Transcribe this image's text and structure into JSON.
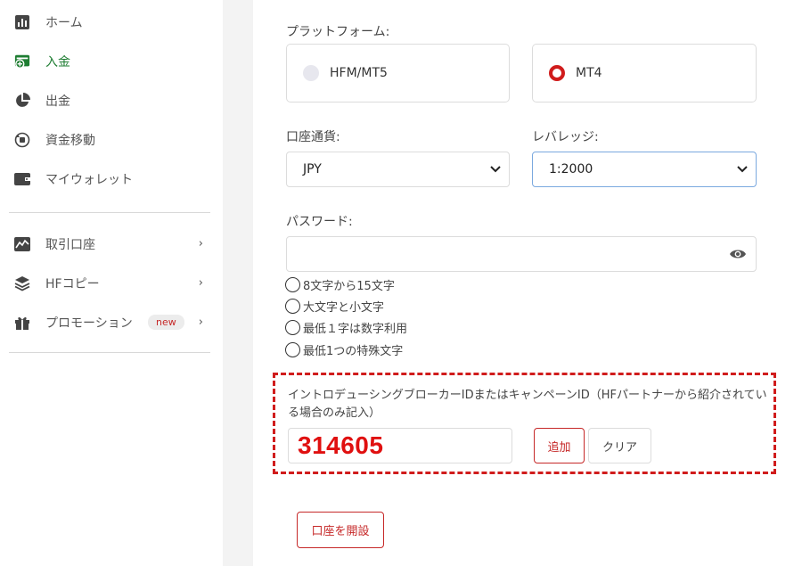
{
  "sidebar": {
    "items": [
      {
        "label": "ホーム"
      },
      {
        "label": "入金"
      },
      {
        "label": "出金"
      },
      {
        "label": "資金移動"
      },
      {
        "label": "マイウォレット"
      },
      {
        "label": "取引口座"
      },
      {
        "label": "HFコピー"
      },
      {
        "label": "プロモーション",
        "badge": "new"
      }
    ],
    "active_color": "#1e7d32"
  },
  "form": {
    "platform_label": "プラットフォーム:",
    "platform_options": [
      {
        "label": "HFM/MT5",
        "selected": false
      },
      {
        "label": "MT4",
        "selected": true
      }
    ],
    "currency_label": "口座通貨:",
    "currency_value": "JPY",
    "leverage_label": "レバレッジ:",
    "leverage_value": "1:2000",
    "password_label": "パスワード:",
    "password_value": "",
    "password_rules": [
      "8文字から15文字",
      "大文字と小文字",
      "最低１字は数字利用",
      "最低1つの特殊文字"
    ],
    "promo_label": "イントロデューシングブローカーIDまたはキャンペーンID（HFパートナーから紹介されている場合のみ記入）",
    "promo_value": "314605",
    "add_button": "追加",
    "clear_button": "クリア",
    "open_account_button": "口座を開設"
  },
  "colors": {
    "accent_red": "#d01c1c",
    "highlight_dashed": "#d01c1c"
  }
}
